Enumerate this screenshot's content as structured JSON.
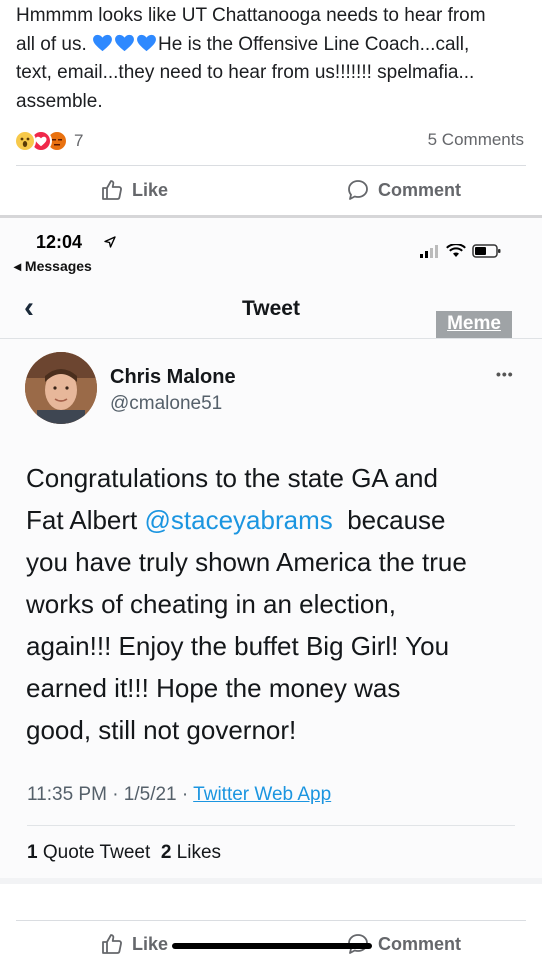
{
  "post": {
    "text_line1": "Hmmmm looks like UT Chattanooga needs to hear from",
    "text_line2_a": "all of us.",
    "text_line2_b": "He is the Offensive Line Coach...call,",
    "text_line3": "text, email...they need to hear from us!!!!!!! spelmafia...",
    "text_line4": "assemble.",
    "heart_color": "#2e89ff",
    "heart_icons": [
      "blue-heart-icon",
      "blue-heart-icon",
      "blue-heart-icon"
    ]
  },
  "reactions": {
    "icons": [
      "wow-reaction-icon",
      "love-reaction-icon",
      "angry-reaction-icon"
    ],
    "count": "7",
    "comments": "5 Comments"
  },
  "actions_top": {
    "like": "Like",
    "comment": "Comment"
  },
  "phone": {
    "time": "12:04",
    "back_app": "◂ Messages"
  },
  "tweet_screen": {
    "title": "Tweet",
    "meme_label": "Meme",
    "user_name": "Chris Malone",
    "user_handle": "@cmalone51",
    "more": "•••",
    "body_line1": "Congratulations to the state GA and",
    "body_line2_a": "Fat Albert",
    "body_mention": "@staceyabrams",
    "body_line2_b": "because",
    "body_line3": "you have truly shown America the true",
    "body_line4": "works of cheating in an election,",
    "body_line5": "again!!!  Enjoy the buffet Big Girl!  You",
    "body_line6": "earned it!!!  Hope the money was",
    "body_line7": "good, still not governor!",
    "meta_time": "11:35 PM · 1/5/21 ·",
    "meta_app": "Twitter Web App",
    "quote_count": "1",
    "quote_label": "Quote Tweet",
    "likes_count": "2",
    "likes_label": "Likes",
    "mention_color": "#1b95e0"
  },
  "actions_bottom": {
    "like": "Like",
    "comment": "Comment"
  }
}
